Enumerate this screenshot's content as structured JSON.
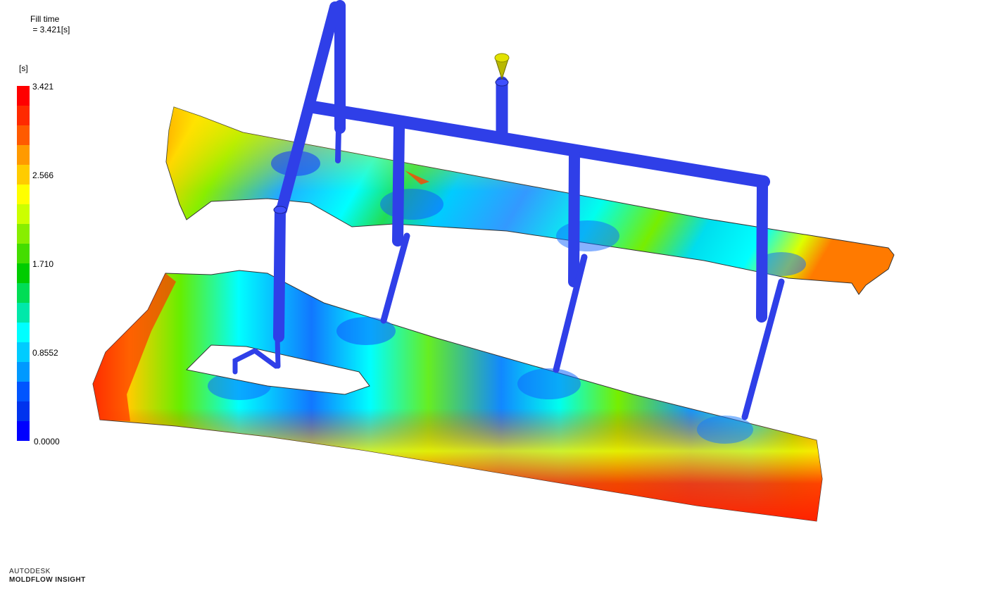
{
  "result": {
    "title": "Fill time",
    "value": " = 3.421[s]"
  },
  "legend": {
    "unit": "[s]",
    "ticks": [
      "3.421",
      "2.566",
      "1.710",
      "0.8552",
      "0.0000"
    ],
    "colors": [
      "#ff0000",
      "#ff2a00",
      "#ff5a00",
      "#ff9a00",
      "#ffcc00",
      "#ffff00",
      "#ccff00",
      "#88ee00",
      "#44dd00",
      "#00cc00",
      "#00dd55",
      "#00e8aa",
      "#00ffff",
      "#00ccff",
      "#0099ff",
      "#0055ff",
      "#0033ee",
      "#0000ff"
    ]
  },
  "brand": {
    "company": "AUTODESK",
    "product": "MOLDFLOW INSIGHT"
  }
}
